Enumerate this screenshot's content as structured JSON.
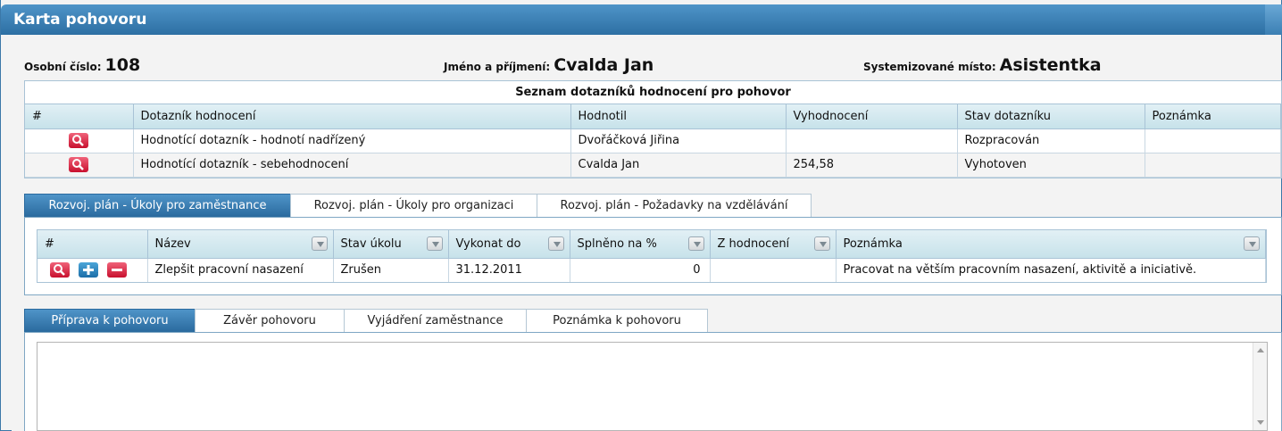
{
  "window": {
    "title": "Karta pohovoru"
  },
  "header": {
    "employee_number_label": "Osobní číslo:",
    "employee_number": "108",
    "name_label": "Jméno a příjmení:",
    "name": "Cvalda Jan",
    "position_label": "Systemizované místo:",
    "position": "Asistentka"
  },
  "questionnaires": {
    "caption": "Seznam dotazníků hodnocení pro pohovor",
    "columns": [
      "#",
      "Dotazník hodnocení",
      "Hodnotil",
      "Vyhodnocení",
      "Stav dotazníku",
      "Poznámka"
    ],
    "rows": [
      {
        "name": "Hodnotící dotazník - hodnotí nadřízený",
        "evaluator": "Dvořáčková Jiřina",
        "score": "",
        "status": "Rozpracován",
        "note": ""
      },
      {
        "name": "Hodnotící dotazník - sebehodnocení",
        "evaluator": "Cvalda Jan",
        "score": "254,58",
        "status": "Vyhotoven",
        "note": ""
      }
    ],
    "view_icon": "magnifier-icon"
  },
  "plan_tabs": [
    {
      "label": "Rozvoj. plán - Úkoly pro zaměstnance",
      "active": true
    },
    {
      "label": "Rozvoj. plán - Úkoly pro organizaci",
      "active": false
    },
    {
      "label": "Rozvoj. plán - Požadavky na vzdělávání",
      "active": false
    }
  ],
  "tasks": {
    "columns": [
      "#",
      "Název",
      "Stav úkolu",
      "Vykonat do",
      "Splněno na %",
      "Z hodnocení",
      "Poznámka"
    ],
    "rows": [
      {
        "name": "Zlepšit pracovní nasazení",
        "status": "Zrušen",
        "due": "31.12.2011",
        "done_pct": "0",
        "from_eval": "",
        "note": "Pracovat na větším pracovním nasazení, aktivitě a iniciativě."
      }
    ],
    "row_icons": [
      "magnifier-icon",
      "plus-icon",
      "minus-icon"
    ]
  },
  "interview_tabs": [
    {
      "label": "Příprava k pohovoru",
      "active": true
    },
    {
      "label": "Závěr pohovoru",
      "active": false
    },
    {
      "label": "Vyjádření zaměstnance",
      "active": false
    },
    {
      "label": "Poznámka k pohovoru",
      "active": false
    }
  ],
  "interview_text": "",
  "colors": {
    "accent": "#2d6fa3",
    "header_row": "#c7e2ea",
    "danger": "#c8102e",
    "add": "#1d6ea8"
  }
}
